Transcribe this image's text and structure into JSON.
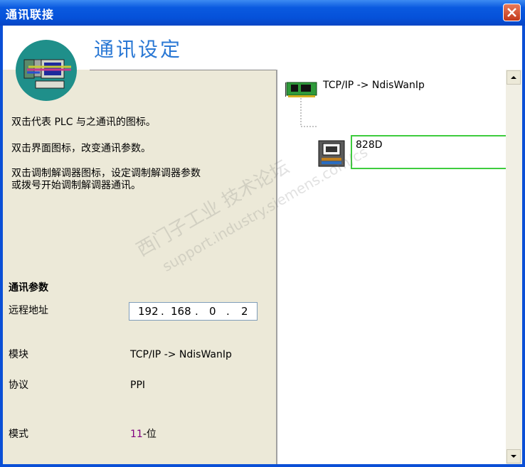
{
  "window": {
    "title": "通讯联接"
  },
  "header": {
    "heading": "通讯设定"
  },
  "instructions": [
    "双击代表 PLC 与之通讯的图标。",
    "双击界面图标，改变通讯参数。",
    "双击调制解调器图标，设定调制解调器参数\n或拨号开始调制解调器通讯。"
  ],
  "params": {
    "section_title": "通讯参数",
    "remote_address_label": "远程地址",
    "ip": [
      "192",
      "168",
      "0",
      "2"
    ],
    "module_label": "模块",
    "module_value": "TCP/IP -> NdisWanIp",
    "protocol_label": "协议",
    "protocol_value": "PPI",
    "mode_label": "模式",
    "mode_value_num": "11",
    "mode_value_unit": "-位"
  },
  "tree": {
    "interface_label": "TCP/IP -> NdisWanIp",
    "device_label": "828D"
  },
  "watermark": {
    "line1": "西门子工业 技术论坛",
    "line2": "support.industry.siemens.com/cs"
  },
  "colors": {
    "heading": "#2a78d4",
    "selection": "#3ecc3e",
    "mode_number": "#800080"
  }
}
